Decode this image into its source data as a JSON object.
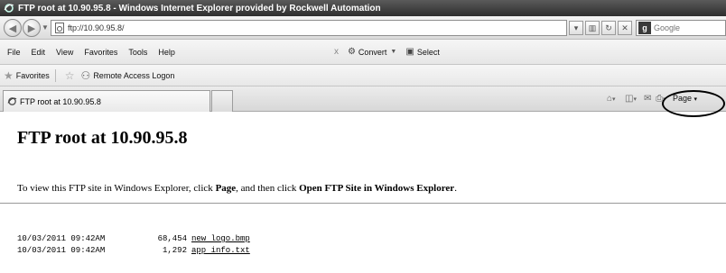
{
  "window": {
    "title": "FTP root at 10.90.95.8 - Windows Internet Explorer provided by Rockwell Automation"
  },
  "address": {
    "url": "ftp://10.90.95.8/"
  },
  "search": {
    "placeholder": "Google",
    "engine_icon": "google-icon"
  },
  "menu": {
    "items": [
      "File",
      "Edit",
      "View",
      "Favorites",
      "Tools",
      "Help"
    ],
    "close_glyph": "x",
    "convert_label": "Convert",
    "select_label": "Select"
  },
  "favorites": {
    "label": "Favorites",
    "remote_access": "Remote Access Logon"
  },
  "tab": {
    "title": "FTP root at 10.90.95.8"
  },
  "commandbar": {
    "page_label": "Page"
  },
  "page": {
    "heading": "FTP root at 10.90.95.8",
    "intro_prefix": "To view this FTP site in Windows Explorer, click ",
    "intro_page": "Page",
    "intro_mid": ", and then click ",
    "intro_open": "Open FTP Site in Windows Explorer",
    "intro_suffix": "."
  },
  "files": [
    {
      "date": "10/03/2011 09:42AM",
      "size": "68,454",
      "name": "new logo.bmp"
    },
    {
      "date": "10/03/2011 09:42AM",
      "size": "1,292",
      "name": "app info.txt"
    }
  ],
  "colors": {
    "titlebar": "#3e3e3e",
    "highlight_circle": "#000000"
  }
}
